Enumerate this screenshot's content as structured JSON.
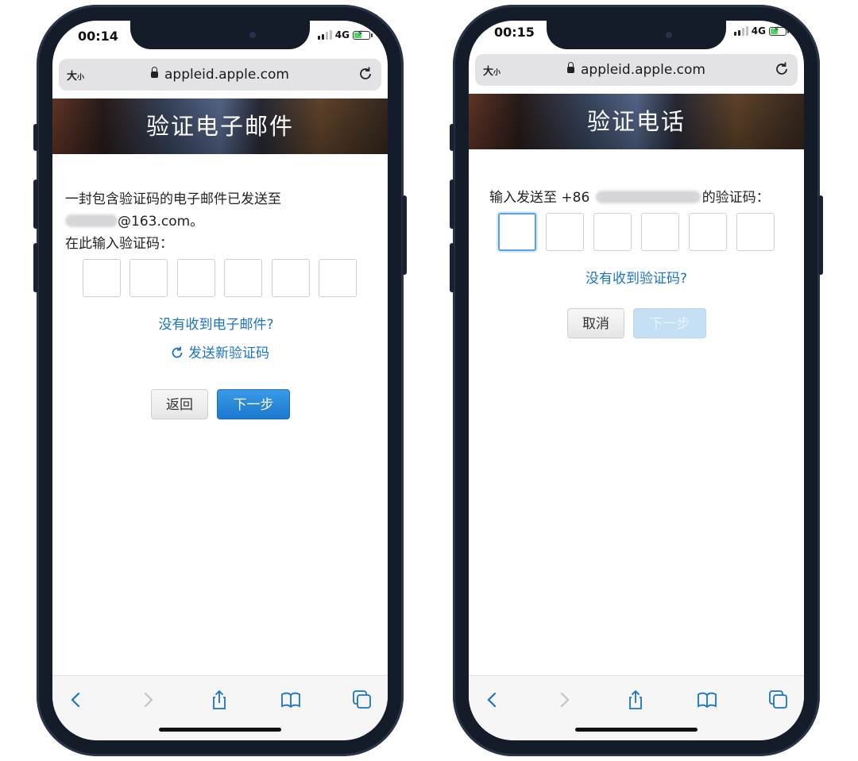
{
  "left": {
    "status": {
      "time": "00:14",
      "network": "4G"
    },
    "urlbar": {
      "text_size_big": "大",
      "text_size_small": "小",
      "url": "appleid.apple.com"
    },
    "banner_title": "验证电子邮件",
    "message_line1": "一封包含验证码的电子邮件已发送至",
    "email_suffix": "@163.com。",
    "prompt": "在此输入验证码：",
    "code_boxes": 6,
    "no_email_link": "没有收到电子邮件?",
    "resend_link": "发送新验证码",
    "back_button": "返回",
    "next_button": "下一步"
  },
  "right": {
    "status": {
      "time": "00:15",
      "network": "4G"
    },
    "urlbar": {
      "text_size_big": "大",
      "text_size_small": "小",
      "url": "appleid.apple.com"
    },
    "banner_title": "验证电话",
    "message_prefix": "输入发送至 +86",
    "message_suffix": "的验证码：",
    "code_boxes": 6,
    "no_code_link": "没有收到验证码?",
    "cancel_button": "取消",
    "next_button": "下一步"
  },
  "toolbar_icons": [
    "back-icon",
    "forward-icon",
    "share-icon",
    "bookmarks-icon",
    "tabs-icon"
  ],
  "colors": {
    "link": "#1a73c7",
    "primary_button": "#1b78cf",
    "phone_frame": "#141b29"
  }
}
